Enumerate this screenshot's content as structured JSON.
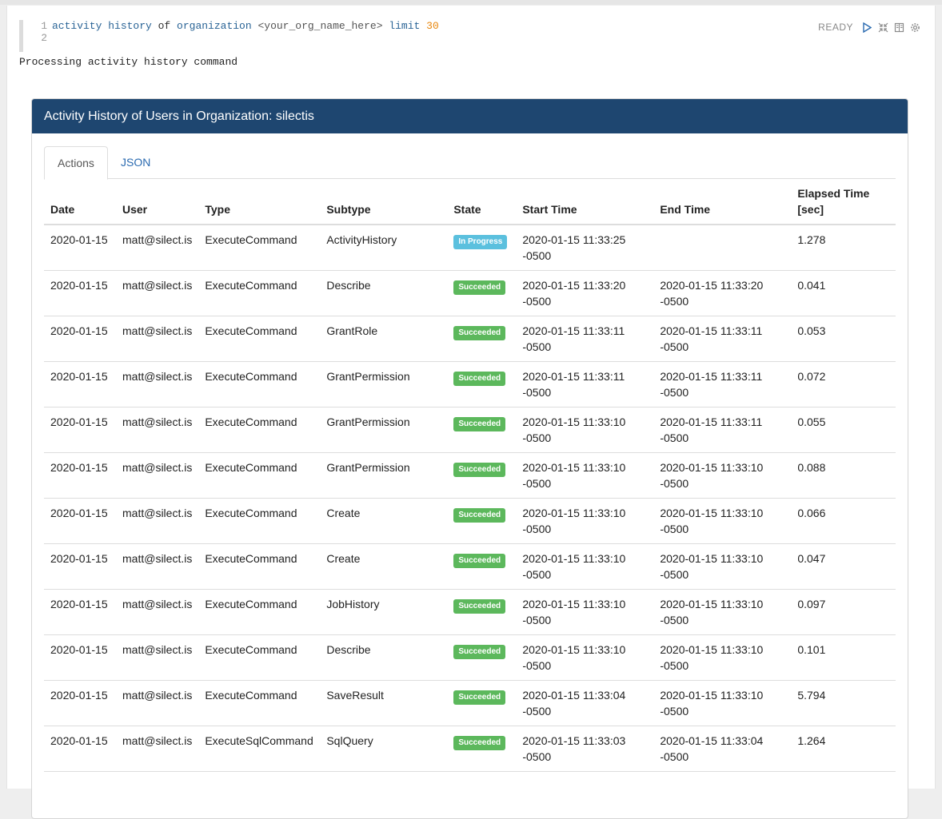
{
  "editor": {
    "lines": [
      {
        "num": "1",
        "tokens": [
          {
            "t": "activity history",
            "c": "kw"
          },
          {
            "t": " of ",
            "c": "plain"
          },
          {
            "t": "organization",
            "c": "kw"
          },
          {
            "t": " <your_org_name_here> ",
            "c": "str"
          },
          {
            "t": "limit",
            "c": "kw"
          },
          {
            "t": " ",
            "c": "plain"
          },
          {
            "t": "30",
            "c": "num"
          }
        ]
      },
      {
        "num": "2",
        "tokens": []
      }
    ]
  },
  "toolbar": {
    "status": "READY",
    "icons": [
      "play-icon",
      "collapse-icon",
      "book-icon",
      "gear-icon"
    ]
  },
  "output_text": "Processing activity history command",
  "panel": {
    "title": "Activity History of Users in Organization: silectis",
    "tabs": [
      {
        "label": "Actions",
        "active": true
      },
      {
        "label": "JSON",
        "active": false
      }
    ]
  },
  "table": {
    "headers": [
      "Date",
      "User",
      "Type",
      "Subtype",
      "State",
      "Start Time",
      "End Time",
      "Elapsed Time [sec]"
    ],
    "rows": [
      {
        "date": "2020-01-15",
        "user": "matt@silect.is",
        "type": "ExecuteCommand",
        "subtype": "ActivityHistory",
        "state": "In Progress",
        "start": "2020-01-15 11:33:25 -0500",
        "end": "",
        "elapsed": "1.278"
      },
      {
        "date": "2020-01-15",
        "user": "matt@silect.is",
        "type": "ExecuteCommand",
        "subtype": "Describe",
        "state": "Succeeded",
        "start": "2020-01-15 11:33:20 -0500",
        "end": "2020-01-15 11:33:20 -0500",
        "elapsed": "0.041"
      },
      {
        "date": "2020-01-15",
        "user": "matt@silect.is",
        "type": "ExecuteCommand",
        "subtype": "GrantRole",
        "state": "Succeeded",
        "start": "2020-01-15 11:33:11 -0500",
        "end": "2020-01-15 11:33:11 -0500",
        "elapsed": "0.053"
      },
      {
        "date": "2020-01-15",
        "user": "matt@silect.is",
        "type": "ExecuteCommand",
        "subtype": "GrantPermission",
        "state": "Succeeded",
        "start": "2020-01-15 11:33:11 -0500",
        "end": "2020-01-15 11:33:11 -0500",
        "elapsed": "0.072"
      },
      {
        "date": "2020-01-15",
        "user": "matt@silect.is",
        "type": "ExecuteCommand",
        "subtype": "GrantPermission",
        "state": "Succeeded",
        "start": "2020-01-15 11:33:10 -0500",
        "end": "2020-01-15 11:33:11 -0500",
        "elapsed": "0.055"
      },
      {
        "date": "2020-01-15",
        "user": "matt@silect.is",
        "type": "ExecuteCommand",
        "subtype": "GrantPermission",
        "state": "Succeeded",
        "start": "2020-01-15 11:33:10 -0500",
        "end": "2020-01-15 11:33:10 -0500",
        "elapsed": "0.088"
      },
      {
        "date": "2020-01-15",
        "user": "matt@silect.is",
        "type": "ExecuteCommand",
        "subtype": "Create",
        "state": "Succeeded",
        "start": "2020-01-15 11:33:10 -0500",
        "end": "2020-01-15 11:33:10 -0500",
        "elapsed": "0.066"
      },
      {
        "date": "2020-01-15",
        "user": "matt@silect.is",
        "type": "ExecuteCommand",
        "subtype": "Create",
        "state": "Succeeded",
        "start": "2020-01-15 11:33:10 -0500",
        "end": "2020-01-15 11:33:10 -0500",
        "elapsed": "0.047"
      },
      {
        "date": "2020-01-15",
        "user": "matt@silect.is",
        "type": "ExecuteCommand",
        "subtype": "JobHistory",
        "state": "Succeeded",
        "start": "2020-01-15 11:33:10 -0500",
        "end": "2020-01-15 11:33:10 -0500",
        "elapsed": "0.097"
      },
      {
        "date": "2020-01-15",
        "user": "matt@silect.is",
        "type": "ExecuteCommand",
        "subtype": "Describe",
        "state": "Succeeded",
        "start": "2020-01-15 11:33:10 -0500",
        "end": "2020-01-15 11:33:10 -0500",
        "elapsed": "0.101"
      },
      {
        "date": "2020-01-15",
        "user": "matt@silect.is",
        "type": "ExecuteCommand",
        "subtype": "SaveResult",
        "state": "Succeeded",
        "start": "2020-01-15 11:33:04 -0500",
        "end": "2020-01-15 11:33:10 -0500",
        "elapsed": "5.794"
      },
      {
        "date": "2020-01-15",
        "user": "matt@silect.is",
        "type": "ExecuteSqlCommand",
        "subtype": "SqlQuery",
        "state": "Succeeded",
        "start": "2020-01-15 11:33:03 -0500",
        "end": "2020-01-15 11:33:04 -0500",
        "elapsed": "1.264"
      }
    ]
  },
  "colors": {
    "header_bg": "#1e4670",
    "in_progress": "#5bc0de",
    "succeeded": "#5cb85c",
    "link": "#2a6ab0"
  }
}
